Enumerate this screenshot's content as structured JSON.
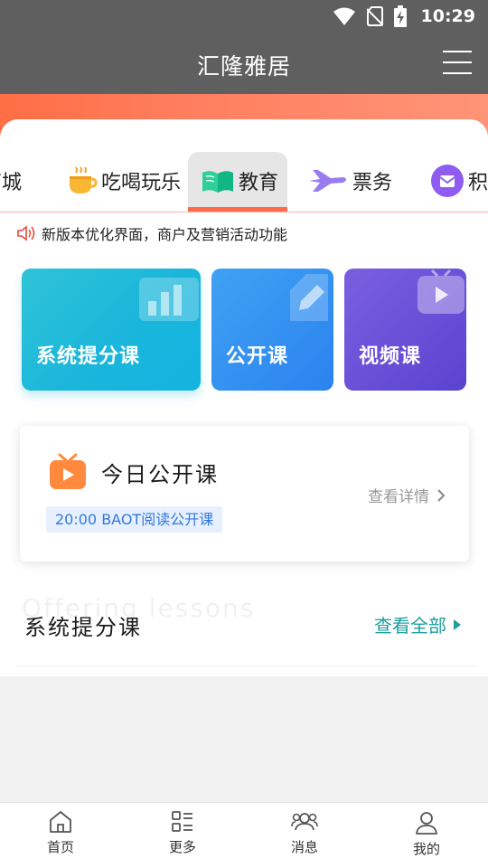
{
  "status": {
    "time": "10:29"
  },
  "header": {
    "title": "汇隆雅居"
  },
  "categories": [
    {
      "label": "商城",
      "icon": "shop-icon"
    },
    {
      "label": "吃喝玩乐",
      "icon": "coffee-icon"
    },
    {
      "label": "教育",
      "icon": "book-icon",
      "active": true
    },
    {
      "label": "票务",
      "icon": "plane-icon"
    },
    {
      "label": "积",
      "icon": "points-icon"
    }
  ],
  "notice": {
    "text": "新版本优化界面，商户及营销活动功能"
  },
  "features": [
    {
      "label": "系统提分课",
      "icon": "chart-icon",
      "color": "#1ab6db"
    },
    {
      "label": "公开课",
      "icon": "pencil-icon",
      "color": "#2b82ef"
    },
    {
      "label": "视频课",
      "icon": "video-icon",
      "color": "#5a43cf"
    }
  ],
  "today": {
    "title": "今日公开课",
    "detail_label": "查看详情",
    "course": "20:00 BAOT阅读公开课"
  },
  "section": {
    "bg_text": "Offering lessons",
    "title": "系统提分课",
    "view_all": "查看全部"
  },
  "nav": [
    {
      "label": "首页",
      "icon": "home-icon"
    },
    {
      "label": "更多",
      "icon": "more-icon"
    },
    {
      "label": "消息",
      "icon": "message-icon"
    },
    {
      "label": "我的",
      "icon": "user-icon"
    }
  ],
  "colors": {
    "accent": "#ff6a4a",
    "teal": "#1e9e9e",
    "header": "#5f5f5f"
  }
}
